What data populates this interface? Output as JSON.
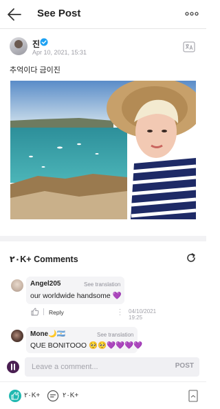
{
  "header": {
    "title": "See Post"
  },
  "post": {
    "author": "진",
    "timestamp": "Apr 10, 2021, 15:31",
    "text": "추억이다 금이진"
  },
  "comments": {
    "count_label": "٢٠K+ Comments",
    "items": [
      {
        "author": "Angel205",
        "translation_label": "See translation",
        "text": "our worldwide handsome 💜",
        "reply_label": "Reply",
        "date": "04/10/2021",
        "time": "19:25"
      },
      {
        "author": "Mone🌙🇦🇷",
        "translation_label": "See translation",
        "text": "QUE BONITOOO 🥺🥺💜💜💜💜"
      }
    ]
  },
  "composer": {
    "placeholder": "Leave a comment...",
    "post_label": "POST"
  },
  "footer": {
    "like_count": "٢٠K+",
    "comment_count": "٢٠K+"
  },
  "colors": {
    "accent_teal": "#1fb8b0",
    "heart_purple": "#a43fe0",
    "verified_blue": "#1da1f2"
  }
}
